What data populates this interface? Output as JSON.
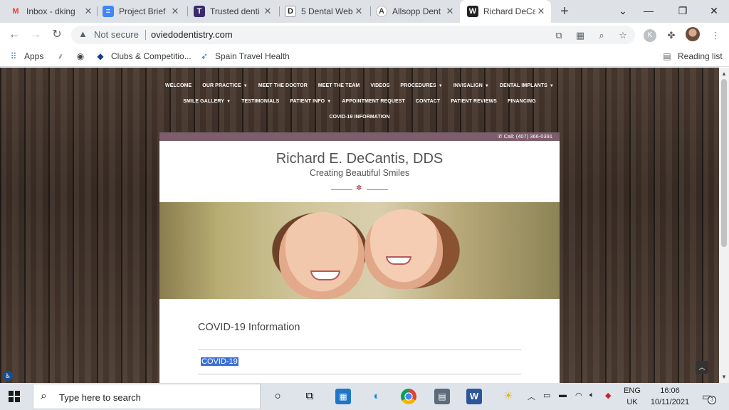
{
  "browser": {
    "tabs": [
      {
        "title": "Inbox - dking",
        "icon": "gmail-icon",
        "color": "#ea4335",
        "glyph": "M"
      },
      {
        "title": "Project Brief",
        "icon": "docs-icon",
        "color": "#4285f4",
        "glyph": "≡"
      },
      {
        "title": "Trusted denti",
        "icon": "site-icon",
        "color": "#3b2a6b",
        "glyph": "T"
      },
      {
        "title": "5 Dental Web",
        "icon": "site-icon",
        "color": "#222222",
        "glyph": "D"
      },
      {
        "title": "Allsopp Dent",
        "icon": "site-icon",
        "color": "#ffffff",
        "glyph": "A"
      },
      {
        "title": "Richard DeCa",
        "icon": "site-icon",
        "color": "#222222",
        "glyph": "W"
      }
    ],
    "tab_close": "✕",
    "new_tab": "+",
    "window_controls": {
      "tab_search": "⌄",
      "minimize": "—",
      "restore": "❐",
      "close": "✕"
    },
    "security_label": "Not secure",
    "url": "oviedodentistry.com",
    "profile_letter": "K",
    "reading_list": "Reading list"
  },
  "bookmarks": [
    {
      "label": "Apps",
      "icon": "apps-grid-icon"
    },
    {
      "label": "",
      "icon": "bookmark-favicon-icon"
    },
    {
      "label": "",
      "icon": "globe-icon"
    },
    {
      "label": "Clubs & Competitio...",
      "icon": "clubs-favicon-icon"
    },
    {
      "label": "Spain Travel Health",
      "icon": "travel-favicon-icon"
    }
  ],
  "site": {
    "nav_row1": [
      {
        "label": "WELCOME",
        "dropdown": false
      },
      {
        "label": "OUR PRACTICE",
        "dropdown": true
      },
      {
        "label": "MEET THE DOCTOR",
        "dropdown": false
      },
      {
        "label": "MEET THE TEAM",
        "dropdown": false
      },
      {
        "label": "VIDEOS",
        "dropdown": false
      },
      {
        "label": "PROCEDURES",
        "dropdown": true
      },
      {
        "label": "INVISALIGN",
        "dropdown": true
      },
      {
        "label": "DENTAL IMPLANTS",
        "dropdown": true
      }
    ],
    "nav_row2": [
      {
        "label": "SMILE GALLERY",
        "dropdown": true
      },
      {
        "label": "TESTIMONIALS",
        "dropdown": false
      },
      {
        "label": "PATIENT INFO",
        "dropdown": true
      },
      {
        "label": "APPOINTMENT REQUEST",
        "dropdown": false
      },
      {
        "label": "CONTACT",
        "dropdown": false
      },
      {
        "label": "PATIENT REVIEWS",
        "dropdown": false
      },
      {
        "label": "FINANCING",
        "dropdown": false
      }
    ],
    "nav_row3": [
      {
        "label": "COVID-19 INFORMATION",
        "dropdown": false
      }
    ],
    "phone": "Call: (407) 366-0391",
    "doctor_name": "Richard E. DeCantis, DDS",
    "tagline": "Creating Beautiful Smiles",
    "page_heading": "COVID-19 Information",
    "covid_link": "COVID-19"
  },
  "taskbar": {
    "search_placeholder": "Type here to search",
    "language": "ENG",
    "region": "UK",
    "time": "16:06",
    "date": "10/11/2021",
    "notification_count": "3"
  }
}
